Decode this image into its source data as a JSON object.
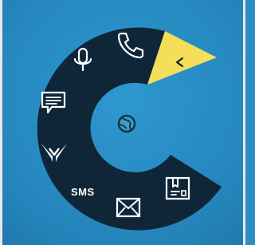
{
  "menu": {
    "items": [
      {
        "name": "call",
        "icon": "phone-icon"
      },
      {
        "name": "voice",
        "icon": "microphone-icon"
      },
      {
        "name": "chat",
        "icon": "chat-bubble-icon"
      },
      {
        "name": "vine",
        "icon": "vine-logo-icon"
      },
      {
        "name": "sms",
        "label": "SMS"
      },
      {
        "name": "email",
        "icon": "envelope-icon"
      },
      {
        "name": "package",
        "icon": "package-icon"
      }
    ],
    "back": {
      "icon": "chevron-left-icon"
    },
    "center": {
      "icon": "globe-icon"
    }
  },
  "colors": {
    "background": "#2586bd",
    "ring": "#0f2638",
    "highlight": "#f4de5a",
    "icon": "#ffffff"
  }
}
